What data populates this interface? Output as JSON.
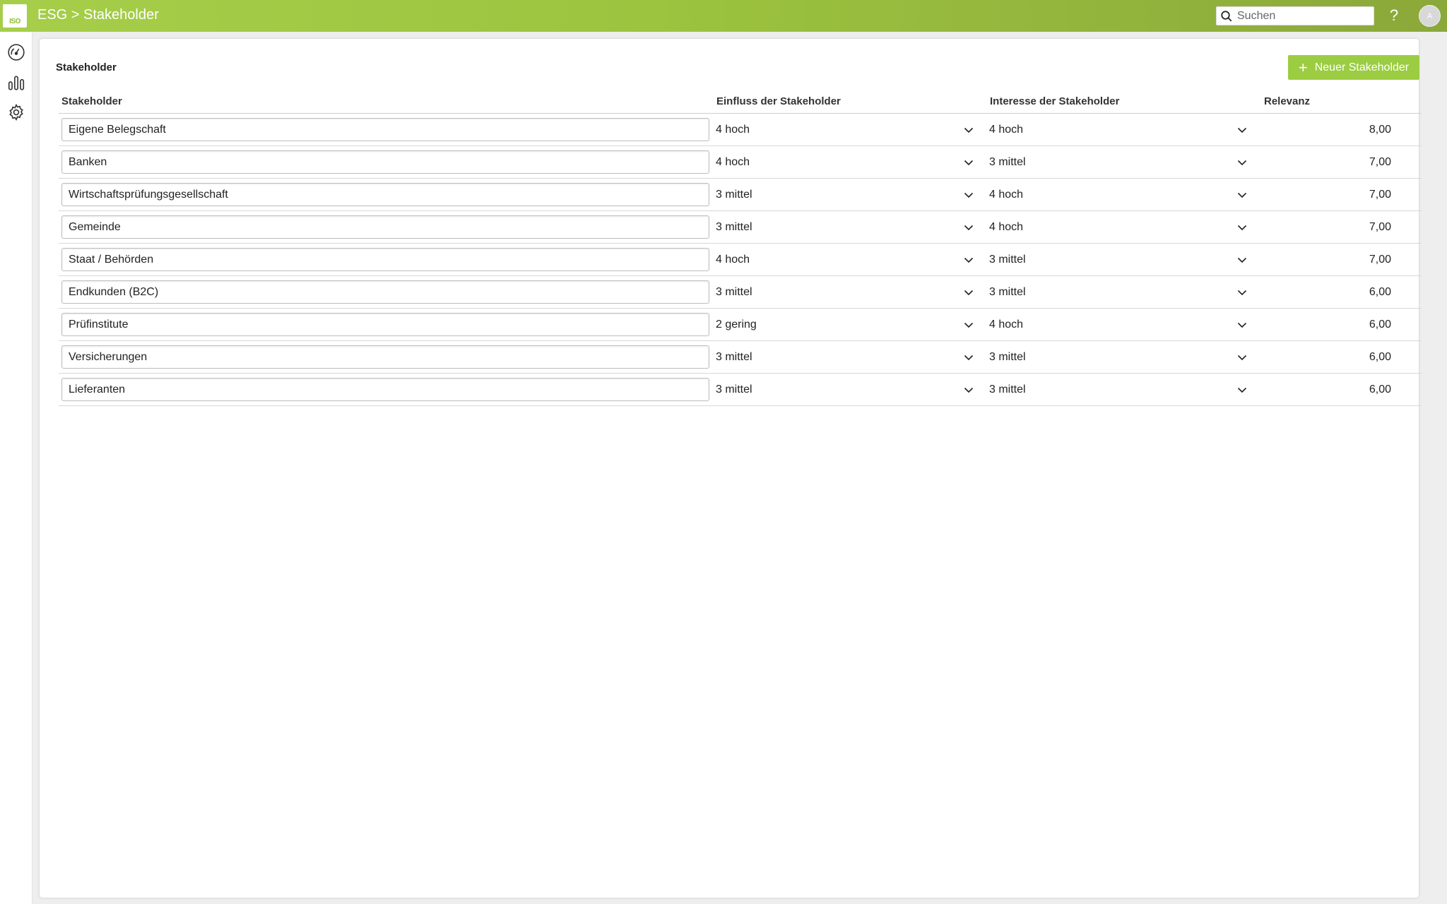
{
  "header": {
    "logo_text": "ISO",
    "title": "ESG > Stakeholder",
    "search_placeholder": "Suchen",
    "help_label": "?",
    "avatar_initial": "A"
  },
  "card": {
    "title": "Stakeholder",
    "new_button_label": "Neuer Stakeholder"
  },
  "table": {
    "columns": {
      "stakeholder": "Stakeholder",
      "einfluss": "Einfluss der Stakeholder",
      "interesse": "Interesse der Stakeholder",
      "relevanz": "Relevanz"
    },
    "rows": [
      {
        "name": "Eigene Belegschaft",
        "einfluss": "4 hoch",
        "interesse": "4 hoch",
        "relevanz": "8,00"
      },
      {
        "name": "Banken",
        "einfluss": "4 hoch",
        "interesse": "3 mittel",
        "relevanz": "7,00"
      },
      {
        "name": "Wirtschaftsprüfungsgesellschaft",
        "einfluss": "3 mittel",
        "interesse": "4 hoch",
        "relevanz": "7,00"
      },
      {
        "name": "Gemeinde",
        "einfluss": "3 mittel",
        "interesse": "4 hoch",
        "relevanz": "7,00"
      },
      {
        "name": "Staat / Behörden",
        "einfluss": "4 hoch",
        "interesse": "3 mittel",
        "relevanz": "7,00"
      },
      {
        "name": "Endkunden (B2C)",
        "einfluss": "3 mittel",
        "interesse": "3 mittel",
        "relevanz": "6,00"
      },
      {
        "name": "Prüfinstitute",
        "einfluss": "2 gering",
        "interesse": "4 hoch",
        "relevanz": "6,00"
      },
      {
        "name": "Versicherungen",
        "einfluss": "3 mittel",
        "interesse": "3 mittel",
        "relevanz": "6,00"
      },
      {
        "name": "Lieferanten",
        "einfluss": "3 mittel",
        "interesse": "3 mittel",
        "relevanz": "6,00"
      }
    ]
  },
  "icons": {
    "dashboard": "gauge-icon",
    "reports": "bar-chart-icon",
    "settings": "gear-icon",
    "search": "search-icon",
    "dropdown": "chevron-down-icon"
  },
  "colors": {
    "accent": "#9ccc42",
    "topbar_start": "#a6ce4a",
    "topbar_end": "#8ba83a"
  }
}
